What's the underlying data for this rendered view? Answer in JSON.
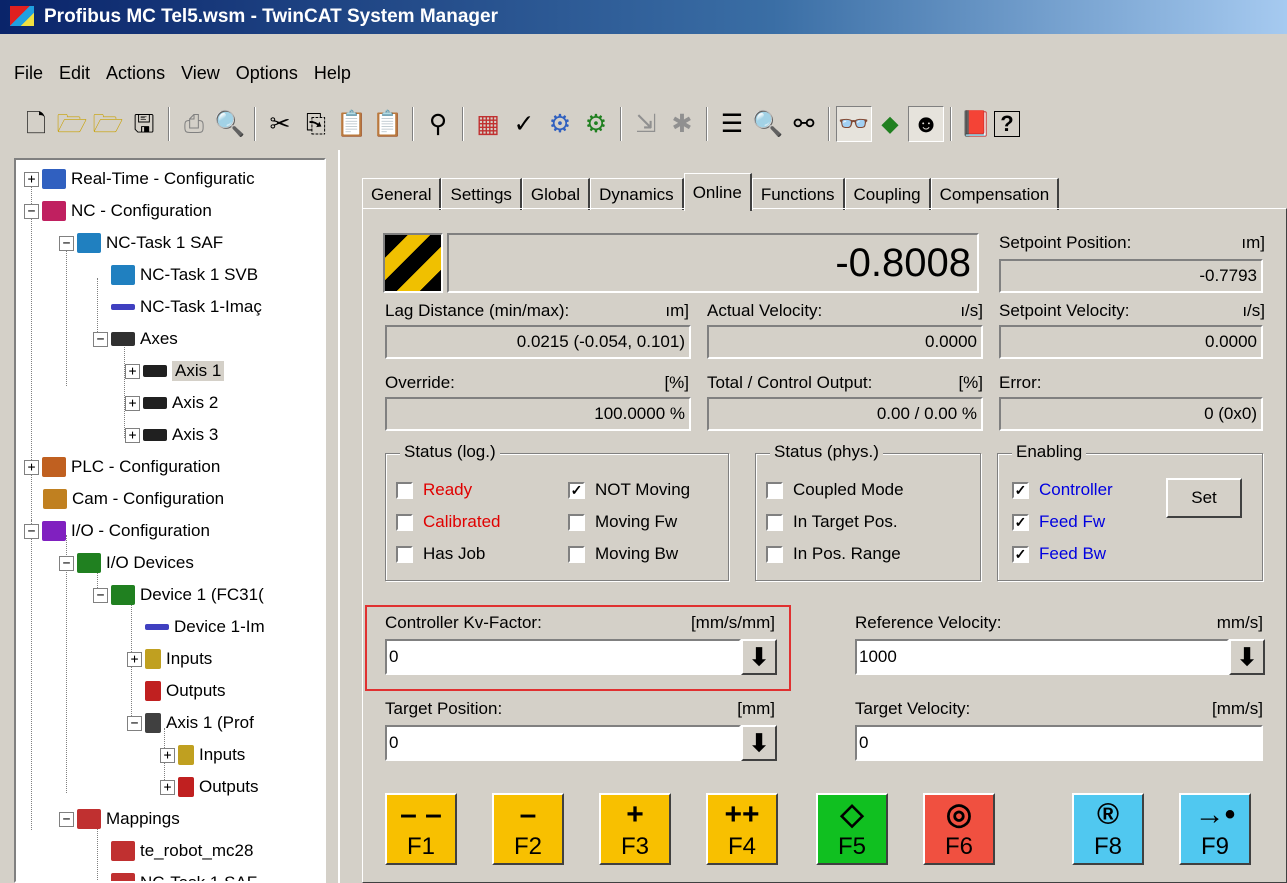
{
  "window": {
    "title": "Profibus MC Tel5.wsm - TwinCAT System Manager"
  },
  "menu": [
    "File",
    "Edit",
    "Actions",
    "View",
    "Options",
    "Help"
  ],
  "tree": [
    {
      "label": "Real-Time - Configuratic",
      "color": "#3060c0"
    },
    {
      "label": "NC - Configuration",
      "color": "#c02060"
    },
    {
      "label": "NC-Task 1 SAF",
      "color": "#2080c0"
    },
    {
      "label": "NC-Task 1 SVB",
      "color": "#2080c0"
    },
    {
      "label": "NC-Task 1-Imaç",
      "color": "#4040c0"
    },
    {
      "label": "Axes",
      "color": "#303030"
    },
    {
      "label": "Axis 1",
      "color": "#202020"
    },
    {
      "label": "Axis 2",
      "color": "#202020"
    },
    {
      "label": "Axis 3",
      "color": "#202020"
    },
    {
      "label": "PLC - Configuration",
      "color": "#c06020"
    },
    {
      "label": "Cam - Configuration",
      "color": "#c08020"
    },
    {
      "label": "I/O - Configuration",
      "color": "#8020c0"
    },
    {
      "label": "I/O Devices",
      "color": "#208020"
    },
    {
      "label": "Device 1 (FC31(",
      "color": "#208020"
    },
    {
      "label": "Device 1-Im",
      "color": "#4040c0"
    },
    {
      "label": "Inputs",
      "color": "#c0a020"
    },
    {
      "label": "Outputs",
      "color": "#c02020"
    },
    {
      "label": "Axis 1 (Prof",
      "color": "#404040"
    },
    {
      "label": "Inputs",
      "color": "#c0a020"
    },
    {
      "label": "Outputs",
      "color": "#c02020"
    },
    {
      "label": "Mappings",
      "color": "#c03030"
    },
    {
      "label": "te_robot_mc28",
      "color": "#c03030"
    },
    {
      "label": "NC-Task 1 SAF ·",
      "color": "#c03030"
    }
  ],
  "tabs": [
    {
      "label": "General",
      "active": false
    },
    {
      "label": "Settings",
      "active": false
    },
    {
      "label": "Global",
      "active": false
    },
    {
      "label": "Dynamics",
      "active": false
    },
    {
      "label": "Online",
      "active": true
    },
    {
      "label": "Functions",
      "active": false
    },
    {
      "label": "Coupling",
      "active": false
    },
    {
      "label": "Compensation",
      "active": false
    }
  ],
  "online": {
    "actual_position": "-0.8008",
    "setpoint_position_label": "Setpoint Position:",
    "setpoint_position_unit": "ım]",
    "setpoint_position": "-0.7793",
    "lag_label": "Lag Distance (min/max):",
    "lag_unit": "ım]",
    "lag_value": "0.0215  (-0.054, 0.101)",
    "actual_velocity_label": "Actual Velocity:",
    "actual_velocity_unit": "ı/s]",
    "actual_velocity": "0.0000",
    "setpoint_velocity_label": "Setpoint Velocity:",
    "setpoint_velocity_unit": "ı/s]",
    "setpoint_velocity": "0.0000",
    "override_label": "Override:",
    "override_unit": "[%]",
    "override": "100.0000 %",
    "total_output_label": "Total / Control Output:",
    "total_output_unit": "[%]",
    "total_output": "0.00 /  0.00 %",
    "error_label": "Error:",
    "error": "0 (0x0)"
  },
  "status_log": {
    "title": "Status (log.)",
    "items": [
      {
        "label": "Ready",
        "checked": false,
        "color": "#e00000"
      },
      {
        "label": "Calibrated",
        "checked": false,
        "color": "#e00000"
      },
      {
        "label": "Has Job",
        "checked": false,
        "color": "#000000"
      },
      {
        "label": "NOT Moving",
        "checked": true,
        "color": "#000000"
      },
      {
        "label": "Moving Fw",
        "checked": false,
        "color": "#000000"
      },
      {
        "label": "Moving Bw",
        "checked": false,
        "color": "#000000"
      }
    ]
  },
  "status_phys": {
    "title": "Status (phys.)",
    "items": [
      {
        "label": "Coupled Mode",
        "checked": false
      },
      {
        "label": "In Target Pos.",
        "checked": false
      },
      {
        "label": "In Pos. Range",
        "checked": false
      }
    ]
  },
  "enabling": {
    "title": "Enabling",
    "items": [
      {
        "label": "Controller",
        "checked": true
      },
      {
        "label": "Feed Fw",
        "checked": true
      },
      {
        "label": "Feed Bw",
        "checked": true
      }
    ],
    "set_button": "Set"
  },
  "inputs": {
    "kv_label": "Controller Kv-Factor:",
    "kv_unit": "[mm/s/mm]",
    "kv_value": "0",
    "ref_vel_label": "Reference Velocity:",
    "ref_vel_unit": "mm/s]",
    "ref_vel_value": "1000",
    "target_pos_label": "Target Position:",
    "target_pos_unit": "[mm]",
    "target_pos_value": "0",
    "target_vel_label": "Target Velocity:",
    "target_vel_unit": "[mm/s]",
    "target_vel_value": "0"
  },
  "fkeys": [
    {
      "key": "F1",
      "symbol": "– –",
      "color": "#f8c000"
    },
    {
      "key": "F2",
      "symbol": "–",
      "color": "#f8c000"
    },
    {
      "key": "F3",
      "symbol": "+",
      "color": "#f8c000"
    },
    {
      "key": "F4",
      "symbol": "++",
      "color": "#f8c000"
    },
    {
      "key": "F5",
      "symbol": "◇",
      "color": "#10c020"
    },
    {
      "key": "F6",
      "symbol": "◎",
      "color": "#f05040"
    },
    {
      "key": "F8",
      "symbol": "®",
      "color": "#50c8f0"
    },
    {
      "key": "F9",
      "symbol": "→•",
      "color": "#50c8f0"
    }
  ],
  "colors": {
    "highlight_box": "#e03030",
    "label_blue": "#0000e0"
  }
}
